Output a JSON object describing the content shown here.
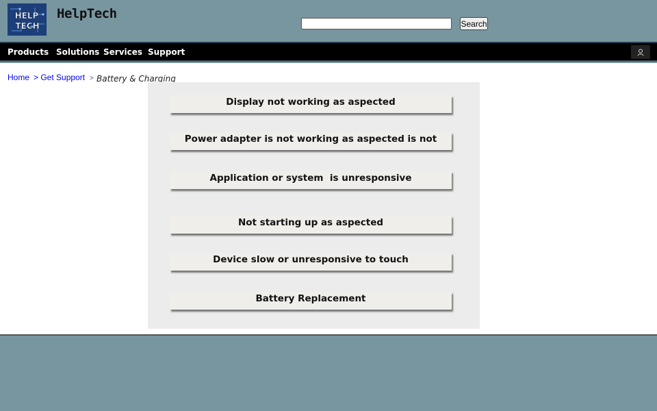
{
  "brand": {
    "name": "HelpTech",
    "logo_text": "HELP TECH"
  },
  "search": {
    "value": "",
    "placeholder": "",
    "button_label": "Search"
  },
  "nav": {
    "items": [
      "Products",
      "Solutions",
      "Services",
      "Support"
    ],
    "user_icon": "user-icon"
  },
  "breadcrumb": {
    "home": "Home",
    "get_support": "> Get Support",
    "separator": ">",
    "current": "Battery & Charging"
  },
  "issues": [
    "Display not working as aspected",
    "Power adapter is not working as aspected is not",
    "Application or system  is unresponsive",
    "Not starting up as aspected",
    "Device slow or unresponsive to touch",
    "Battery Replacement"
  ]
}
